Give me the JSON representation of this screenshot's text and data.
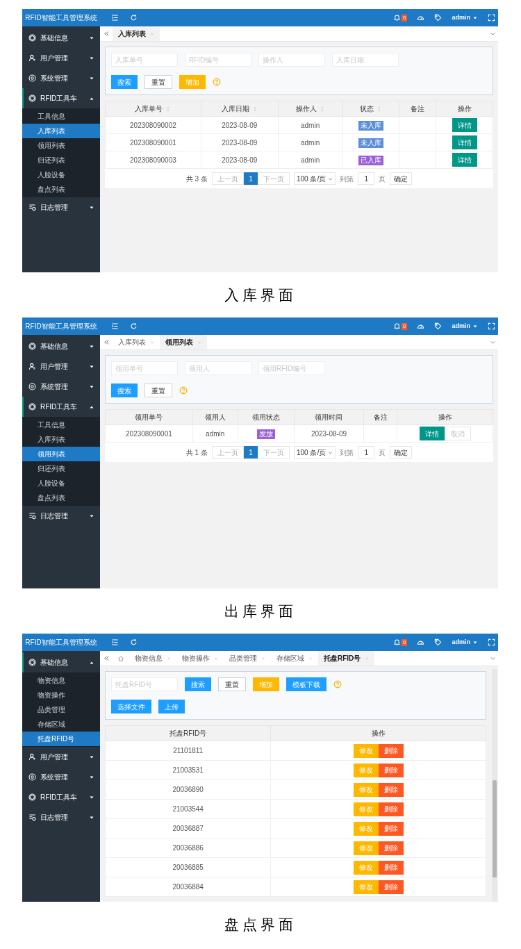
{
  "panels": [
    {
      "app_title": "RFID智能工具管理系统",
      "notifications": "0",
      "user": "admin",
      "sidebar": [
        {
          "label": "基础信息",
          "expanded": false
        },
        {
          "label": "用户管理",
          "expanded": false
        },
        {
          "label": "系统管理",
          "expanded": false
        },
        {
          "label": "RFID工具车",
          "expanded": true,
          "children": [
            {
              "label": "工具信息",
              "selected": false
            },
            {
              "label": "入库列表",
              "selected": true
            },
            {
              "label": "领用列表",
              "selected": false
            },
            {
              "label": "归还列表",
              "selected": false
            },
            {
              "label": "人脸设备",
              "selected": false
            },
            {
              "label": "盘点列表",
              "selected": false
            }
          ]
        },
        {
          "label": "日志管理",
          "expanded": false
        }
      ],
      "home_tab": false,
      "tabs": [
        {
          "label": "入库列表",
          "selected": true
        }
      ],
      "toolbar_rows": [
        {
          "items": [
            {
              "kind": "input",
              "placeholder": "入库单号"
            },
            {
              "kind": "input",
              "placeholder": "RFID编号"
            },
            {
              "kind": "input",
              "placeholder": "操作人"
            },
            {
              "kind": "input",
              "placeholder": "入库日期"
            }
          ]
        },
        {
          "items": [
            {
              "kind": "primary",
              "label": "搜索"
            },
            {
              "kind": "plain",
              "label": "重置"
            },
            {
              "kind": "warm",
              "label": "增加"
            },
            {
              "kind": "help"
            }
          ]
        }
      ],
      "table": {
        "columns": [
          {
            "label": "入库单号",
            "sortable": true
          },
          {
            "label": "入库日期",
            "sortable": true
          },
          {
            "label": "操作人",
            "sortable": true
          },
          {
            "label": "状态",
            "sortable": true
          },
          {
            "label": "备注",
            "sortable": false
          },
          {
            "label": "操作",
            "sortable": false
          }
        ],
        "rows": [
          {
            "cells": [
              {
                "kind": "text",
                "text": "202308090002"
              },
              {
                "kind": "text",
                "text": "2023-08-09"
              },
              {
                "kind": "text",
                "text": "admin"
              },
              {
                "kind": "tag",
                "text": "未入库",
                "color": "#5b8fd6"
              },
              {
                "kind": "empty"
              },
              {
                "kind": "actions",
                "buttons": [
                  {
                    "label": "详情",
                    "kind": "teal"
                  }
                ]
              }
            ]
          },
          {
            "cells": [
              {
                "kind": "text",
                "text": "202308090001"
              },
              {
                "kind": "text",
                "text": "2023-08-09"
              },
              {
                "kind": "text",
                "text": "admin"
              },
              {
                "kind": "tag",
                "text": "未入库",
                "color": "#5b8fd6"
              },
              {
                "kind": "empty"
              },
              {
                "kind": "actions",
                "buttons": [
                  {
                    "label": "详情",
                    "kind": "teal"
                  }
                ]
              }
            ]
          },
          {
            "cells": [
              {
                "kind": "text",
                "text": "202308090003"
              },
              {
                "kind": "text",
                "text": "2023-08-09"
              },
              {
                "kind": "text",
                "text": "admin"
              },
              {
                "kind": "tag",
                "text": "已入库",
                "color": "#9b5fd8"
              },
              {
                "kind": "empty"
              },
              {
                "kind": "actions",
                "buttons": [
                  {
                    "label": "详情",
                    "kind": "teal"
                  }
                ]
              }
            ]
          }
        ]
      },
      "pagination": {
        "total": "共 3 条",
        "prev": "上一页",
        "pages": [
          {
            "label": "1",
            "selected": true
          }
        ],
        "next": "下一页",
        "page_size": "100 条/页",
        "goto": "到第",
        "page": "1",
        "page_unit": "页",
        "confirm": "确定"
      },
      "scrollbar": false,
      "caption": "入库界面"
    },
    {
      "app_title": "RFID智能工具管理系统",
      "notifications": "0",
      "user": "admin",
      "sidebar": [
        {
          "label": "基础信息",
          "expanded": false
        },
        {
          "label": "用户管理",
          "expanded": false
        },
        {
          "label": "系统管理",
          "expanded": false
        },
        {
          "label": "RFID工具车",
          "expanded": true,
          "children": [
            {
              "label": "工具信息",
              "selected": false
            },
            {
              "label": "入库列表",
              "selected": false
            },
            {
              "label": "领用列表",
              "selected": true
            },
            {
              "label": "归还列表",
              "selected": false
            },
            {
              "label": "人脸设备",
              "selected": false
            },
            {
              "label": "盘点列表",
              "selected": false
            }
          ]
        },
        {
          "label": "日志管理",
          "expanded": false
        }
      ],
      "home_tab": false,
      "tabs": [
        {
          "label": "入库列表",
          "selected": false
        },
        {
          "label": "领用列表",
          "selected": true
        }
      ],
      "toolbar_rows": [
        {
          "items": [
            {
              "kind": "input",
              "placeholder": "领用单号"
            },
            {
              "kind": "input",
              "placeholder": "领用人"
            },
            {
              "kind": "input",
              "placeholder": "领用RFID编号"
            }
          ]
        },
        {
          "items": [
            {
              "kind": "primary",
              "label": "搜索"
            },
            {
              "kind": "plain",
              "label": "重置"
            },
            {
              "kind": "help"
            }
          ]
        }
      ],
      "table": {
        "columns": [
          {
            "label": "领用单号",
            "sortable": false
          },
          {
            "label": "领用人",
            "sortable": false
          },
          {
            "label": "领用状态",
            "sortable": false
          },
          {
            "label": "领用时间",
            "sortable": false
          },
          {
            "label": "备注",
            "sortable": false
          },
          {
            "label": "操作",
            "sortable": false
          }
        ],
        "rows": [
          {
            "cells": [
              {
                "kind": "text",
                "text": "202308090001"
              },
              {
                "kind": "text",
                "text": "admin"
              },
              {
                "kind": "tag",
                "text": "发放",
                "color": "#9b5fd8"
              },
              {
                "kind": "text",
                "text": "2023-08-09"
              },
              {
                "kind": "empty"
              },
              {
                "kind": "actions",
                "buttons": [
                  {
                    "label": "详情",
                    "kind": "teal"
                  },
                  {
                    "label": "取消",
                    "kind": "disabled"
                  }
                ]
              }
            ]
          }
        ]
      },
      "pagination": {
        "total": "共 1 条",
        "prev": "上一页",
        "pages": [
          {
            "label": "1",
            "selected": true
          }
        ],
        "next": "下一页",
        "page_size": "100 条/页",
        "goto": "到第",
        "page": "1",
        "page_unit": "页",
        "confirm": "确定"
      },
      "scrollbar": false,
      "caption": "出库界面"
    },
    {
      "app_title": "RFID智能工具管理系统",
      "notifications": "0",
      "user": "admin",
      "sidebar": [
        {
          "label": "基础信息",
          "expanded": true,
          "children": [
            {
              "label": "物资信息",
              "selected": false
            },
            {
              "label": "物资操作",
              "selected": false
            },
            {
              "label": "品类管理",
              "selected": false
            },
            {
              "label": "存储区域",
              "selected": false
            },
            {
              "label": "托盘RFID号",
              "selected": true
            }
          ]
        },
        {
          "label": "用户管理",
          "expanded": false
        },
        {
          "label": "系统管理",
          "expanded": false
        },
        {
          "label": "RFID工具车",
          "expanded": false
        },
        {
          "label": "日志管理",
          "expanded": false
        }
      ],
      "home_tab": true,
      "tabs": [
        {
          "label": "物资信息",
          "selected": false
        },
        {
          "label": "物资操作",
          "selected": false
        },
        {
          "label": "品类管理",
          "selected": false
        },
        {
          "label": "存储区域",
          "selected": false
        },
        {
          "label": "托盘RFID号",
          "selected": true
        }
      ],
      "toolbar_rows": [
        {
          "items": [
            {
              "kind": "input",
              "placeholder": "托盘RFID号"
            },
            {
              "kind": "primary",
              "label": "搜索"
            },
            {
              "kind": "plain",
              "label": "重置"
            },
            {
              "kind": "warm",
              "label": "增加"
            },
            {
              "kind": "primary",
              "label": "模板下载"
            },
            {
              "kind": "help"
            }
          ]
        },
        {
          "items": [
            {
              "kind": "primary",
              "label": "选择文件"
            },
            {
              "kind": "primary",
              "label": "上传"
            }
          ]
        }
      ],
      "table": {
        "columns": [
          {
            "label": "托盘RFID号",
            "sortable": false
          },
          {
            "label": "操作",
            "sortable": false
          }
        ],
        "rows": [
          {
            "cells": [
              {
                "kind": "text",
                "text": "21101811"
              },
              {
                "kind": "actions",
                "buttons": [
                  {
                    "label": "修改",
                    "kind": "warm"
                  },
                  {
                    "label": "删除",
                    "kind": "danger"
                  }
                ]
              }
            ]
          },
          {
            "cells": [
              {
                "kind": "text",
                "text": "21003531"
              },
              {
                "kind": "actions",
                "buttons": [
                  {
                    "label": "修改",
                    "kind": "warm"
                  },
                  {
                    "label": "删除",
                    "kind": "danger"
                  }
                ]
              }
            ]
          },
          {
            "cells": [
              {
                "kind": "text",
                "text": "20036890"
              },
              {
                "kind": "actions",
                "buttons": [
                  {
                    "label": "修改",
                    "kind": "warm"
                  },
                  {
                    "label": "删除",
                    "kind": "danger"
                  }
                ]
              }
            ]
          },
          {
            "cells": [
              {
                "kind": "text",
                "text": "21003544"
              },
              {
                "kind": "actions",
                "buttons": [
                  {
                    "label": "修改",
                    "kind": "warm"
                  },
                  {
                    "label": "删除",
                    "kind": "danger"
                  }
                ]
              }
            ]
          },
          {
            "cells": [
              {
                "kind": "text",
                "text": "20036887"
              },
              {
                "kind": "actions",
                "buttons": [
                  {
                    "label": "修改",
                    "kind": "warm"
                  },
                  {
                    "label": "删除",
                    "kind": "danger"
                  }
                ]
              }
            ]
          },
          {
            "cells": [
              {
                "kind": "text",
                "text": "20036886"
              },
              {
                "kind": "actions",
                "buttons": [
                  {
                    "label": "修改",
                    "kind": "warm"
                  },
                  {
                    "label": "删除",
                    "kind": "danger"
                  }
                ]
              }
            ]
          },
          {
            "cells": [
              {
                "kind": "text",
                "text": "20036885"
              },
              {
                "kind": "actions",
                "buttons": [
                  {
                    "label": "修改",
                    "kind": "warm"
                  },
                  {
                    "label": "删除",
                    "kind": "danger"
                  }
                ]
              }
            ]
          },
          {
            "cells": [
              {
                "kind": "text",
                "text": "20036884"
              },
              {
                "kind": "actions",
                "buttons": [
                  {
                    "label": "修改",
                    "kind": "warm"
                  },
                  {
                    "label": "删除",
                    "kind": "danger"
                  }
                ]
              }
            ]
          }
        ]
      },
      "scrollbar": true,
      "caption": "盘点界面"
    }
  ]
}
